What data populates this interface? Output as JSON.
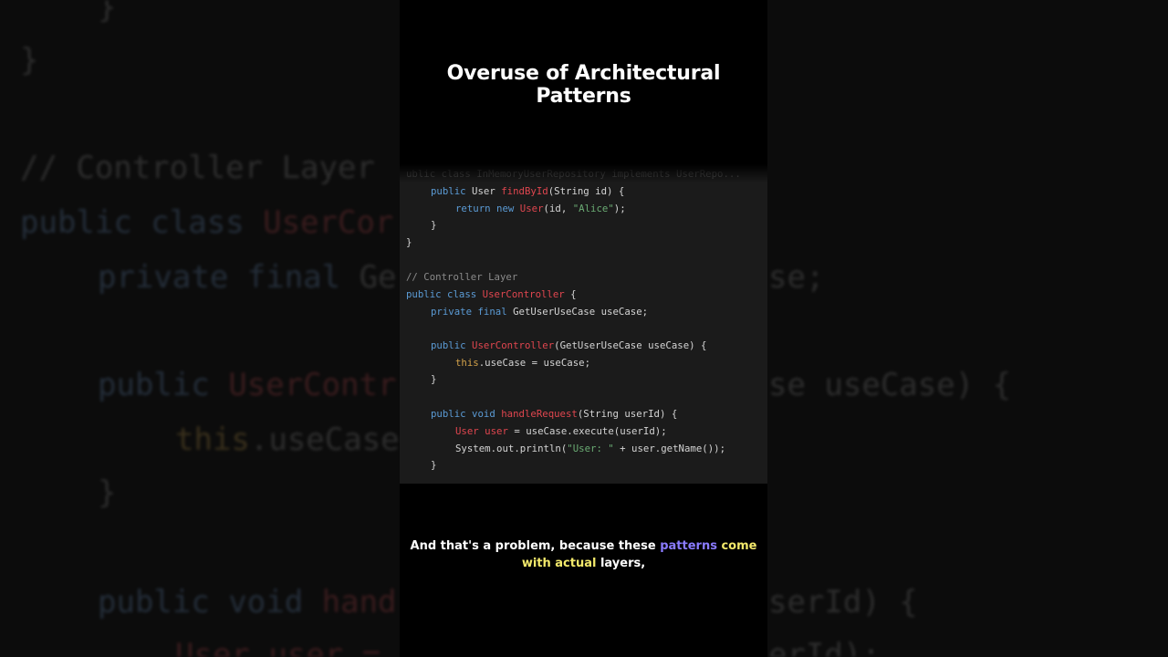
{
  "title": "Overuse of Architectural Patterns",
  "caption": {
    "part1": "And that's a problem, because these ",
    "word_patterns": "patterns",
    "word_come": " come",
    "word_with_actual": "with actual",
    "part2": " layers,"
  },
  "colors": {
    "keyword": "#5b9bd5",
    "class_name": "#e0464f",
    "string": "#6aab73",
    "comment": "#8a8a8a",
    "this_keyword": "#d3a24a",
    "caption_highlight_purple": "#8a7bff",
    "caption_highlight_yellow": "#f3e96b"
  },
  "code": {
    "line0": "ublic class InMemoryUserRepository implements UserRepo...",
    "line1_kw": "public",
    "line1_type": " User ",
    "line1_fn": "findById",
    "line1_rest": "(String id) {",
    "line2_kw": "return new",
    "line2_cls": " User",
    "line2_mid": "(id, ",
    "line2_str": "\"Alice\"",
    "line2_end": ");",
    "line3": "}",
    "line4": "}",
    "line5_comment": "// Controller Layer",
    "line6_kw": "public class",
    "line6_cls": " UserController",
    "line6_end": " {",
    "line7_kw": "private final",
    "line7_rest": " GetUserUseCase useCase;",
    "line8_kw": "public",
    "line8_cls": " UserController",
    "line8_rest": "(GetUserUseCase useCase) {",
    "line9_this": "this",
    "line9_rest": ".useCase = useCase;",
    "line10": "}",
    "line11_kw": "public void",
    "line11_fn": " handleRequest",
    "line11_rest": "(String userId) {",
    "line12_cls": "User",
    "line12_var": " user",
    "line12_rest": " = useCase.execute(userId);",
    "line13_a": "System.out.println(",
    "line13_str": "\"User: \"",
    "line13_b": " + user.getName());",
    "line14": "}"
  },
  "bg_code": {
    "l1": "}",
    "l2": "}",
    "l3": "// Controller Layer",
    "l4_kw": "public class ",
    "l4_cls": "UserCor",
    "l5_kw": "private final ",
    "l5_rest": "Ge",
    "l5_tail": "se;",
    "l6_kw": "public ",
    "l6_cls": "UserContr",
    "l6_tail": "se useCase) {",
    "l7_this": "this",
    "l7_rest": ".useCase",
    "l8": "}",
    "l9_kw": "public void ",
    "l9_fn": "hand",
    "l9_tail": "serId) {",
    "l10_cls": "User user =",
    "l10_tail": "erId);"
  }
}
